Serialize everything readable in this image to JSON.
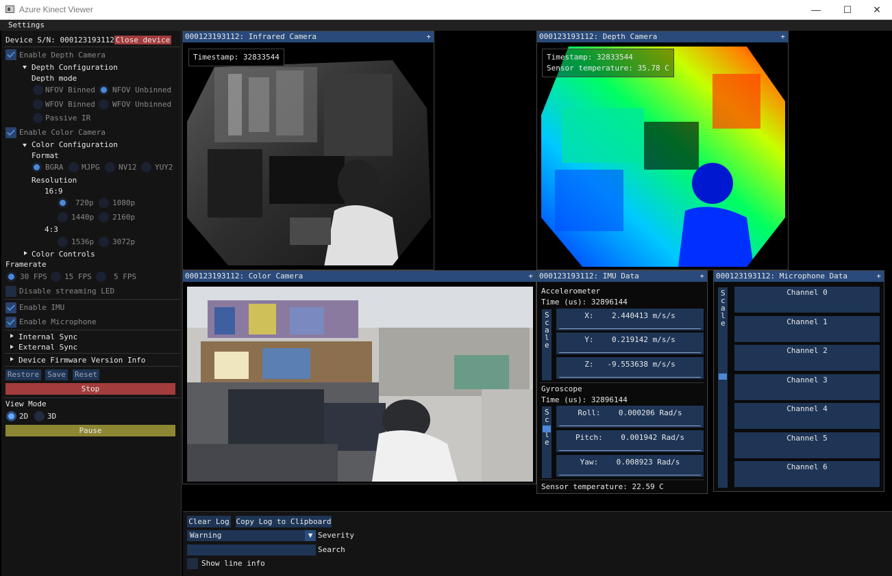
{
  "window": {
    "title": "Azure Kinect Viewer",
    "minimize": "—",
    "maximize": "☐",
    "close": "✕"
  },
  "menu": {
    "settings": "Settings"
  },
  "sidebar": {
    "device_label": "Device S/N: 000123193112",
    "close_device": "Close device",
    "enable_depth": "Enable Depth Camera",
    "depth_config": "Depth Configuration",
    "depth_mode": "Depth mode",
    "depth_modes": [
      "NFOV Binned",
      "NFOV Unbinned",
      "WFOV Binned",
      "WFOV Unbinned",
      "Passive IR"
    ],
    "enable_color": "Enable Color Camera",
    "color_config": "Color Configuration",
    "format": "Format",
    "formats": [
      "BGRA",
      "MJPG",
      "NV12",
      "YUY2"
    ],
    "resolution": "Resolution",
    "ratio_169": "16:9",
    "res_169": [
      "720p",
      "1080p",
      "1440p",
      "2160p"
    ],
    "ratio_43": "4:3",
    "res_43": [
      "1536p",
      "3072p"
    ],
    "color_controls": "Color Controls",
    "framerate": "Framerate",
    "fps": [
      "30 FPS",
      "15 FPS",
      "5 FPS"
    ],
    "disable_led": "Disable streaming LED",
    "enable_imu": "Enable IMU",
    "enable_mic": "Enable Microphone",
    "internal_sync": "Internal Sync",
    "external_sync": "External Sync",
    "firmware": "Device Firmware Version Info",
    "restore": "Restore",
    "save": "Save",
    "reset": "Reset",
    "stop": "Stop",
    "view_mode": "View Mode",
    "view_2d": "2D",
    "view_3d": "3D",
    "pause": "Pause"
  },
  "ir": {
    "title": "000123193112: Infrared Camera",
    "timestamp": "Timestamp: 32833544"
  },
  "depth": {
    "title": "000123193112: Depth Camera",
    "timestamp": "Timestamp: 32833544",
    "temp": "Sensor temperature: 35.78 C"
  },
  "color": {
    "title": "000123193112: Color Camera"
  },
  "imu": {
    "title": "000123193112: IMU Data",
    "accel": "Accelerometer",
    "accel_time": "Time (us): 32896144",
    "accel_x": "X:    2.440413 m/s/s",
    "accel_y": "Y:    0.219142 m/s/s",
    "accel_z": "Z:   -9.553638 m/s/s",
    "gyro": "Gyroscope",
    "gyro_time": "Time (us): 32896144",
    "roll": "Roll:    0.000206 Rad/s",
    "pitch": "Pitch:    0.001942 Rad/s",
    "yaw": "Yaw:    0.008923 Rad/s",
    "scale": "Scale",
    "temp": "Sensor temperature: 22.59 C"
  },
  "mic": {
    "title": "000123193112: Microphone Data",
    "scale": "Scale",
    "channels": [
      "Channel 0",
      "Channel 1",
      "Channel 2",
      "Channel 3",
      "Channel 4",
      "Channel 5",
      "Channel 6"
    ]
  },
  "log": {
    "clear": "Clear Log",
    "copy": "Copy Log to Clipboard",
    "severity_value": "Warning",
    "severity_label": "Severity",
    "search_label": "Search",
    "show_line_info": "Show line info"
  },
  "plus": "+"
}
